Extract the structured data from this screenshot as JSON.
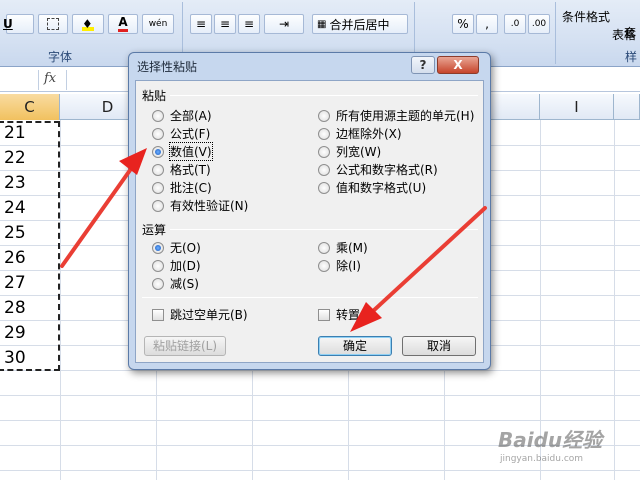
{
  "ribbon": {
    "font_group_label": "字体",
    "merge_center_label": "合并后居中",
    "conditional_format_label": "条件格式",
    "table_format_label_partial": "表格",
    "apply_label_partial": "套",
    "style_group_label_partial": "样",
    "percent_label": "%",
    "comma_label": ",",
    "underline_label": "U",
    "font_color_label": "A",
    "phonetic_label": "wén"
  },
  "formula_bar": {
    "fx_label": "fx"
  },
  "columns": [
    "C",
    "D",
    "I"
  ],
  "rows": [
    {
      "c": "21"
    },
    {
      "c": "22"
    },
    {
      "c": "23"
    },
    {
      "c": "24"
    },
    {
      "c": "25"
    },
    {
      "c": "26"
    },
    {
      "c": "27"
    },
    {
      "c": "28"
    },
    {
      "c": "29"
    },
    {
      "c": "30"
    }
  ],
  "dialog": {
    "title": "选择性粘贴",
    "help_label": "?",
    "close_label": "X",
    "paste_section": "粘贴",
    "paste_options_left": [
      "全部(A)",
      "公式(F)",
      "数值(V)",
      "格式(T)",
      "批注(C)",
      "有效性验证(N)"
    ],
    "paste_options_right": [
      "所有使用源主题的单元(H)",
      "边框除外(X)",
      "列宽(W)",
      "公式和数字格式(R)",
      "值和数字格式(U)"
    ],
    "selected_paste": "数值(V)",
    "operation_section": "运算",
    "operation_left": [
      "无(O)",
      "加(D)",
      "减(S)"
    ],
    "operation_right": [
      "乘(M)",
      "除(I)"
    ],
    "selected_operation": "无(O)",
    "skip_blanks": "跳过空单元(B)",
    "transpose": "转置(E)",
    "paste_link_button": "粘贴链接(L)",
    "ok_button": "确定",
    "cancel_button": "取消"
  },
  "watermark": {
    "brand": "Baidu经验",
    "url": "jingyan.baidu.com"
  },
  "colors": {
    "accent": "#1659c0",
    "arrow": "#e8231f",
    "ribbon": "#d5e1f2"
  }
}
